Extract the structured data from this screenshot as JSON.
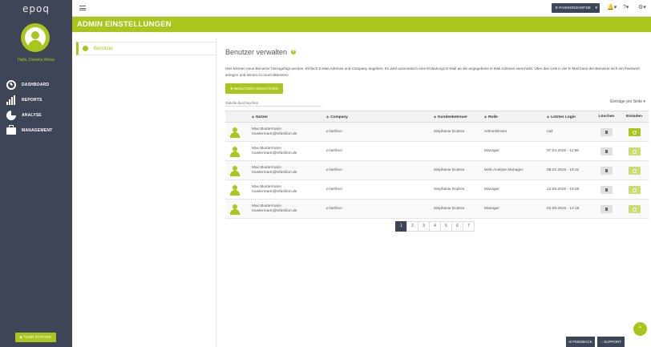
{
  "sidebar": {
    "logo": "epoq",
    "greeting": "Hallo, Daniela Weiss",
    "items": [
      {
        "label": "DASHBOARD",
        "icon": "dashboard-icon"
      },
      {
        "label": "REPORTS",
        "icon": "reports-icon"
      },
      {
        "label": "ANALYSE",
        "icon": "analyse-icon"
      },
      {
        "label": "MANAGEMENT",
        "icon": "management-icon"
      }
    ],
    "tour_label": "▶ TOUR STARTEN"
  },
  "topbar": {
    "shop": "E-FASHIONSHOP.DE",
    "bell": "🔔▾",
    "help": "?▾",
    "gear": "⚙▾"
  },
  "header": {
    "title": "ADMIN EINSTELLUNGEN"
  },
  "settings": {
    "item": "Benutzer"
  },
  "main": {
    "title": "Benutzer verwalten",
    "description": "Hier können neue Benutzer hinzugefügt werden. Einfach E-Mail Adresse und Company angeben. Es wird automatisch eine Einladungs E-Mail an die angegebene E-Mail Adresse verschickt. Über den Link in der E-Mail kann der Benutzer sich ein Passwort anlegen und seinen Account aktivieren.",
    "add_button": "✚ BENUTZER HINZUFÜGEN",
    "search_placeholder": "Tabelle durchsuchen",
    "per_page": "Einträge pro Seite  ▾",
    "columns": {
      "user": "Nutzer",
      "company": "Company",
      "manager": "Kundenbetreuer",
      "role": "Rolle",
      "login": "Letztes Login",
      "delete": "Löschen",
      "invite": "Einladen"
    },
    "rows": [
      {
        "name": "Max Mustermann",
        "email": "mustermann@efashion.de",
        "company": "e-fashion",
        "manager": "Stephanie Endres",
        "role": "Administrator",
        "login": "null",
        "invite_active": true
      },
      {
        "name": "Max Mustermann",
        "email": "mustermann@efashion.de",
        "company": "e-fashion",
        "manager": "",
        "role": "Manager",
        "login": "07.04.2015 - 11:56",
        "invite_active": false
      },
      {
        "name": "Max Mustermann",
        "email": "mustermann@efashion.de",
        "company": "e-fashion",
        "manager": "Stephanie Endres",
        "role": "Web Analyse Manager",
        "login": "08.02.2015 - 10:31",
        "invite_active": false
      },
      {
        "name": "Max Mustermann",
        "email": "mustermann@efashion.de",
        "company": "e-fashion",
        "manager": "Stephanie Endres",
        "role": "Manager",
        "login": "12.09.2015 - 16:26",
        "invite_active": false
      },
      {
        "name": "Max Mustermann",
        "email": "mustermann@efashion.de",
        "company": "e-fashion",
        "manager": "Stephanie Endres",
        "role": "Manager",
        "login": "02.09.2015 - 12:19",
        "invite_active": false
      }
    ],
    "pages": [
      "1",
      "2",
      "3",
      "4",
      "5",
      "6",
      "7"
    ],
    "active_page": "1"
  },
  "footer": {
    "feedback": "✉ FEEDBACK",
    "support": "◌ SUPPORT",
    "scroll_top": "⌃"
  },
  "colors": {
    "accent": "#a8c61b",
    "accent_light": "#c9dd73",
    "sidebar": "#3d4556"
  }
}
